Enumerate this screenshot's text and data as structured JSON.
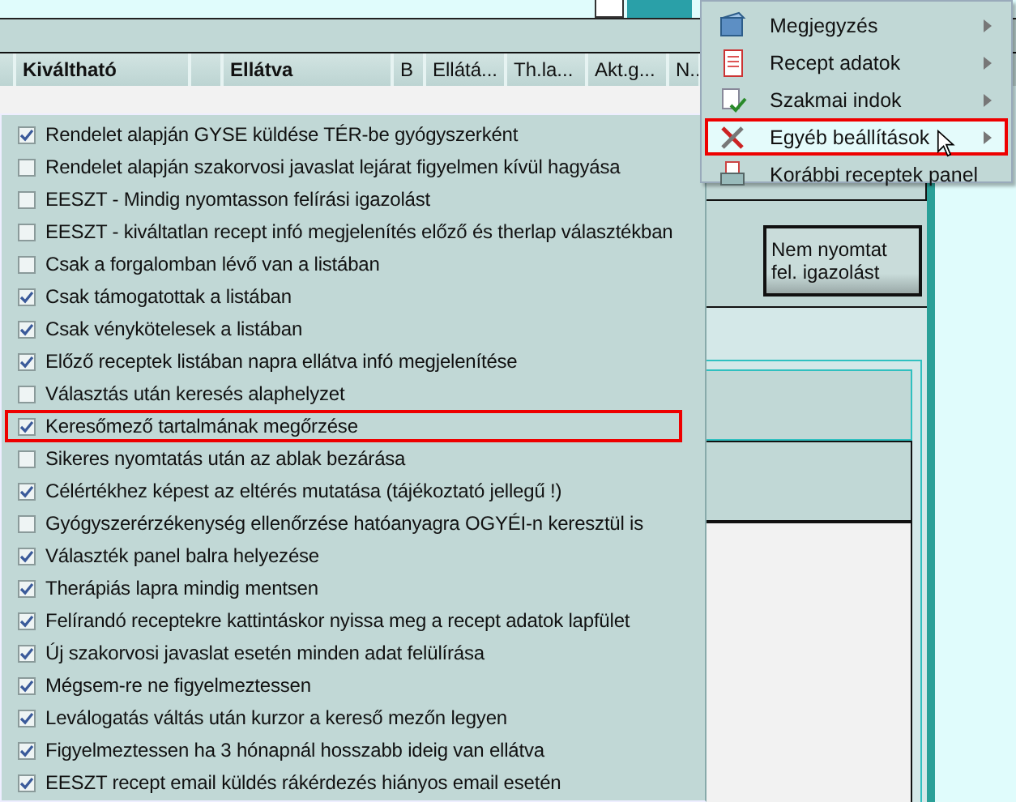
{
  "table": {
    "columns": [
      {
        "label": "Kiváltható",
        "bold": true
      },
      {
        "label": "Ellátva",
        "bold": true
      },
      {
        "label": "B",
        "bold": false
      },
      {
        "label": "Ellátá...",
        "bold": false
      },
      {
        "label": "Th.la...",
        "bold": false
      },
      {
        "label": "Akt.g...",
        "bold": false
      },
      {
        "label": "N..",
        "bold": false
      }
    ]
  },
  "side_button": {
    "lines": [
      "Nem nyomtat",
      "fel. igazolást"
    ]
  },
  "context_menu": {
    "items": [
      {
        "label": "Megjegyzés",
        "kind": "note",
        "submenu": true,
        "hovered": false,
        "outlined": false
      },
      {
        "label": "Recept adatok",
        "kind": "document",
        "submenu": true,
        "hovered": false,
        "outlined": false
      },
      {
        "label": "Szakmai indok",
        "kind": "checklist",
        "submenu": true,
        "hovered": false,
        "outlined": false
      },
      {
        "label": "Egyéb beállítások",
        "kind": "tools",
        "submenu": true,
        "hovered": true,
        "outlined": true
      },
      {
        "label": "Korábbi receptek panel",
        "kind": "printer",
        "submenu": false,
        "hovered": false,
        "outlined": false
      }
    ]
  },
  "settings_menu": {
    "items": [
      {
        "label": "Rendelet alapján GYSE küldése TÉR-be gyógyszerként",
        "checked": true,
        "outlined": false
      },
      {
        "label": "Rendelet alapján szakorvosi javaslat lejárat figyelmen kívül hagyása",
        "checked": false,
        "outlined": false
      },
      {
        "label": "EESZT - Mindig nyomtasson felírási igazolást",
        "checked": false,
        "outlined": false
      },
      {
        "label": "EESZT - kiváltatlan recept infó megjelenítés előző és therlap választékban",
        "checked": false,
        "outlined": false
      },
      {
        "label": "Csak a forgalomban lévő van a listában",
        "checked": false,
        "outlined": false
      },
      {
        "label": "Csak támogatottak a listában",
        "checked": true,
        "outlined": false
      },
      {
        "label": "Csak vénykötelesek a listában",
        "checked": true,
        "outlined": false
      },
      {
        "label": "Előző receptek listában napra ellátva infó megjelenítése",
        "checked": true,
        "outlined": false
      },
      {
        "label": "Választás után keresés alaphelyzet",
        "checked": false,
        "outlined": false
      },
      {
        "label": "Keresőmező tartalmának megőrzése",
        "checked": true,
        "outlined": true
      },
      {
        "label": "Sikeres nyomtatás után az ablak bezárása",
        "checked": false,
        "outlined": false
      },
      {
        "label": "Célértékhez képest az eltérés mutatása (tájékoztató jellegű !)",
        "checked": true,
        "outlined": false
      },
      {
        "label": "Gyógyszerérzékenység ellenőrzése hatóanyagra OGYÉI-n keresztül is",
        "checked": false,
        "outlined": false
      },
      {
        "label": "Választék panel balra helyezése",
        "checked": true,
        "outlined": false
      },
      {
        "label": "Therápiás lapra mindig mentsen",
        "checked": true,
        "outlined": false
      },
      {
        "label": "Felírandó receptekre kattintáskor nyissa meg a recept adatok lapfület",
        "checked": true,
        "outlined": false
      },
      {
        "label": "Új szakorvosi javaslat esetén minden adat felülírása",
        "checked": true,
        "outlined": false
      },
      {
        "label": "Mégsem-re ne figyelmeztessen",
        "checked": true,
        "outlined": false
      },
      {
        "label": "Leválogatás váltás után kurzor a kereső mezőn legyen",
        "checked": true,
        "outlined": false
      },
      {
        "label": "Figyelmeztessen ha 3 hónapnál hosszabb ideig van ellátva",
        "checked": true,
        "outlined": false
      },
      {
        "label": "EESZT recept email küldés rákérdezés hiányos email esetén",
        "checked": true,
        "outlined": false
      }
    ]
  }
}
